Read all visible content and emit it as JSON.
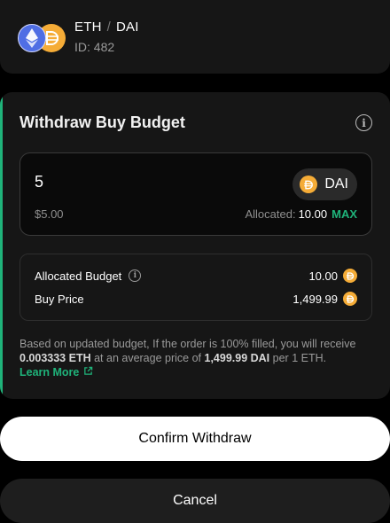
{
  "pair": {
    "base": "ETH",
    "separator": "/",
    "quote": "DAI",
    "id_text": "ID: 482",
    "base_icon": "eth-icon",
    "quote_icon": "dai-icon"
  },
  "form": {
    "title": "Withdraw Buy Budget",
    "amount_value": "5",
    "token": "DAI",
    "usd_value": "$5.00",
    "allocated_label": "Allocated:",
    "allocated_value": "10.00",
    "max_label": "MAX"
  },
  "details": {
    "allocated_budget_label": "Allocated Budget",
    "allocated_budget_value": "10.00",
    "buy_price_label": "Buy Price",
    "buy_price_value": "1,499.99"
  },
  "note": {
    "part1": "Based on updated budget, If the order is 100% filled, you will receive",
    "eth_amount": "0.003333 ETH",
    "part2": "at an average price of",
    "price": "1,499.99 DAI",
    "part3": "per 1 ETH.",
    "learn_more": "Learn More"
  },
  "buttons": {
    "confirm": "Confirm Withdraw",
    "cancel": "Cancel"
  },
  "colors": {
    "accent": "#1fb37a",
    "eth": "#4f6ee4",
    "dai": "#f5ac37",
    "card": "#161616"
  }
}
